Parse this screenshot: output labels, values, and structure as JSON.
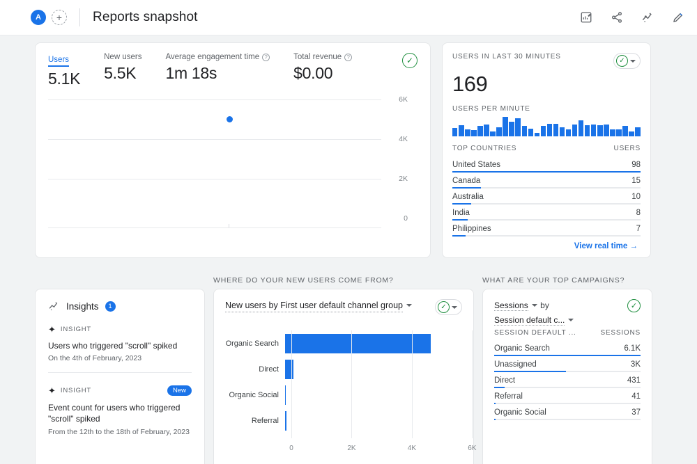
{
  "topbar": {
    "avatar_initial": "A",
    "add_label": "+",
    "title": "Reports snapshot",
    "actions": [
      {
        "name": "insights-report-icon",
        "label": "Insights report"
      },
      {
        "name": "share-icon",
        "label": "Share"
      },
      {
        "name": "analysis-icon",
        "label": "Analysis"
      },
      {
        "name": "edit-icon",
        "label": "Edit"
      }
    ]
  },
  "overview": {
    "metrics": [
      {
        "label": "Users",
        "value": "5.1K",
        "active": true,
        "help": false
      },
      {
        "label": "New users",
        "value": "5.5K",
        "active": false,
        "help": false
      },
      {
        "label": "Average engagement time",
        "value": "1m 18s",
        "active": false,
        "help": true
      },
      {
        "label": "Total revenue",
        "value": "$0.00",
        "active": false,
        "help": true
      }
    ],
    "check_glyph": "✓",
    "chart_data": {
      "type": "scatter",
      "title": "Users over time",
      "xlabel": "",
      "ylabel": "",
      "ylim": [
        0,
        6800
      ],
      "yticks": [
        "6K",
        "4K",
        "2K",
        "0"
      ],
      "ytick_values": [
        6000,
        4000,
        2000,
        0
      ],
      "grid": true,
      "series": [
        {
          "name": "Users",
          "color": "#1a73e8",
          "points": [
            {
              "x": 0.49,
              "y": 5100
            }
          ]
        }
      ]
    }
  },
  "realtime": {
    "header": "Users in last 30 minutes",
    "value": "169",
    "per_minute_label": "Users per minute",
    "check_glyph": "✓",
    "chart_data": {
      "type": "bar",
      "title": "Users per minute",
      "categories": [
        "1",
        "2",
        "3",
        "4",
        "5",
        "6",
        "7",
        "8",
        "9",
        "10",
        "11",
        "12",
        "13",
        "14",
        "15",
        "16",
        "17",
        "18",
        "19",
        "20",
        "21",
        "22",
        "23",
        "24",
        "25",
        "26",
        "27",
        "28",
        "29",
        "30"
      ],
      "values": [
        10,
        13,
        8,
        7,
        12,
        14,
        6,
        11,
        23,
        17,
        21,
        12,
        9,
        4,
        12,
        15,
        15,
        11,
        8,
        14,
        19,
        13,
        14,
        13,
        14,
        8,
        8,
        12,
        6,
        11
      ],
      "color": "#1a73e8",
      "ylabel": "Users"
    },
    "table": {
      "col_dimension": "Top countries",
      "col_metric": "Users",
      "rows": [
        {
          "name": "United States",
          "value": "98",
          "pct": 100
        },
        {
          "name": "Canada",
          "value": "15",
          "pct": 15
        },
        {
          "name": "Australia",
          "value": "10",
          "pct": 10
        },
        {
          "name": "India",
          "value": "8",
          "pct": 8
        },
        {
          "name": "Philippines",
          "value": "7",
          "pct": 7
        }
      ]
    },
    "view_link": "View real time",
    "view_arrow": "→"
  },
  "sections": {
    "new_users": "Where do your new users come from?",
    "campaigns": "What are your top campaigns?"
  },
  "insights": {
    "title": "Insights",
    "count": "1",
    "items": [
      {
        "tag": "Insight",
        "headline": "Users who triggered \"scroll\" spiked",
        "sub": "On the 4th of February, 2023",
        "badge": ""
      },
      {
        "tag": "Insight",
        "headline": "Event count for users who triggered \"scroll\" spiked",
        "sub": "From the 12th to the 18th of February, 2023",
        "badge": "New"
      }
    ]
  },
  "channels": {
    "title": "New users by First user default channel group",
    "check_glyph": "✓",
    "chart_data": {
      "type": "bar",
      "orientation": "horizontal",
      "title": "New users by First user default channel group",
      "categories": [
        "Organic Search",
        "Direct",
        "Organic Social",
        "Referral"
      ],
      "values": [
        5100,
        300,
        30,
        40
      ],
      "xlabel": "",
      "ylabel": "",
      "xlim": [
        0,
        6200
      ],
      "xticks": [
        "0",
        "2K",
        "4K",
        "6K"
      ],
      "xtick_values": [
        0,
        2000,
        4000,
        6000
      ],
      "color": "#1a73e8"
    }
  },
  "campaigns": {
    "metric_select": "Sessions",
    "by_label": "by",
    "dimension_select": "Session default c...",
    "col_dimension": "Session default ...",
    "col_metric": "Sessions",
    "check_glyph": "✓",
    "rows": [
      {
        "name": "Organic Search",
        "value": "6.1K",
        "pct": 100
      },
      {
        "name": "Unassigned",
        "value": "3K",
        "pct": 49
      },
      {
        "name": "Direct",
        "value": "431",
        "pct": 7
      },
      {
        "name": "Referral",
        "value": "41",
        "pct": 1
      },
      {
        "name": "Organic Social",
        "value": "37",
        "pct": 1
      }
    ]
  }
}
